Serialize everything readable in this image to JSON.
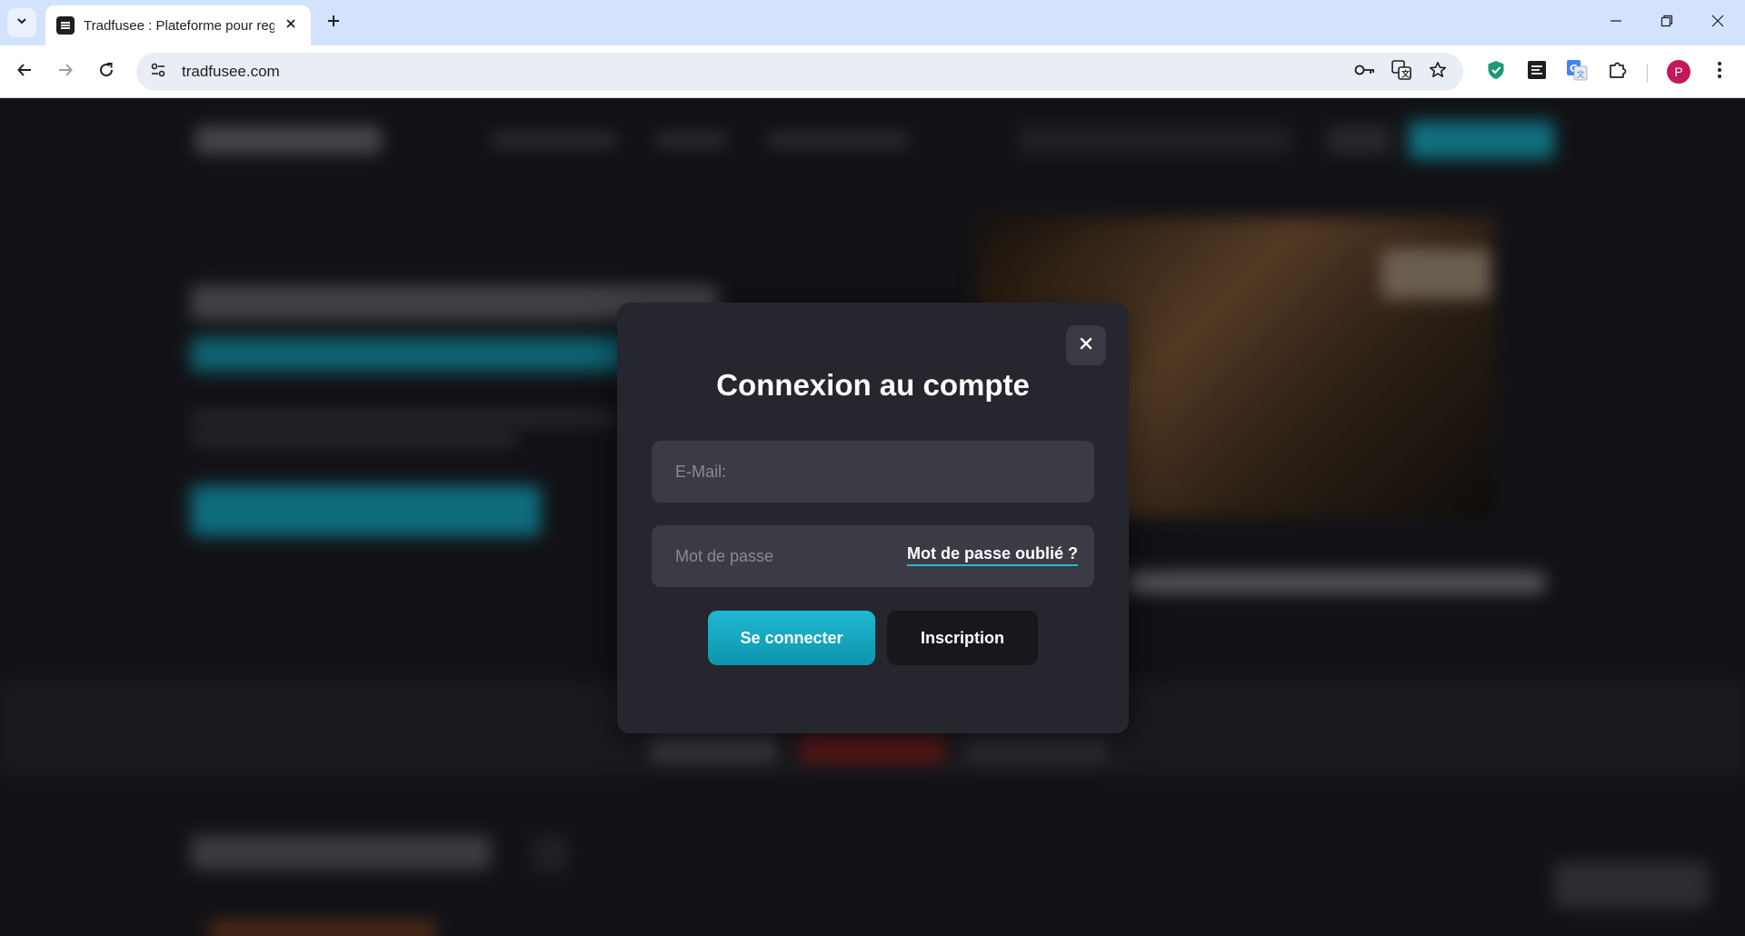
{
  "browser": {
    "tab_title": "Tradfusee : Plateforme pour regarder",
    "url": "tradfusee.com",
    "profile_initial": "P"
  },
  "colors": {
    "accent": "#1aa9c3",
    "modal_bg": "#26262e",
    "field_bg": "#3b3b45",
    "register_bg": "#17171c"
  },
  "icons": {
    "tab_search": "chevron-down-icon",
    "favicon": "tradfusee-favicon-icon",
    "tab_close": "close-icon",
    "new_tab": "plus-icon",
    "minimize": "minimize-icon",
    "restore": "restore-icon",
    "window_close": "close-icon",
    "back": "arrow-left-icon",
    "forward": "arrow-right-icon",
    "reload": "reload-icon",
    "site_info": "tune-icon",
    "password": "key-icon",
    "translate": "translate-icon",
    "bookmark": "star-icon",
    "extensions": [
      "shield-extension-icon",
      "notes-extension-icon",
      "google-translate-icon",
      "puzzle-icon"
    ],
    "menu": "kebab-menu-icon",
    "modal_close": "close-icon"
  },
  "modal": {
    "title": "Connexion au compte",
    "email_placeholder": "E-Mail:",
    "password_placeholder": "Mot de passe",
    "forgot_password": "Mot de passe oublié ?",
    "login_button": "Se connecter",
    "register_button": "Inscription"
  }
}
